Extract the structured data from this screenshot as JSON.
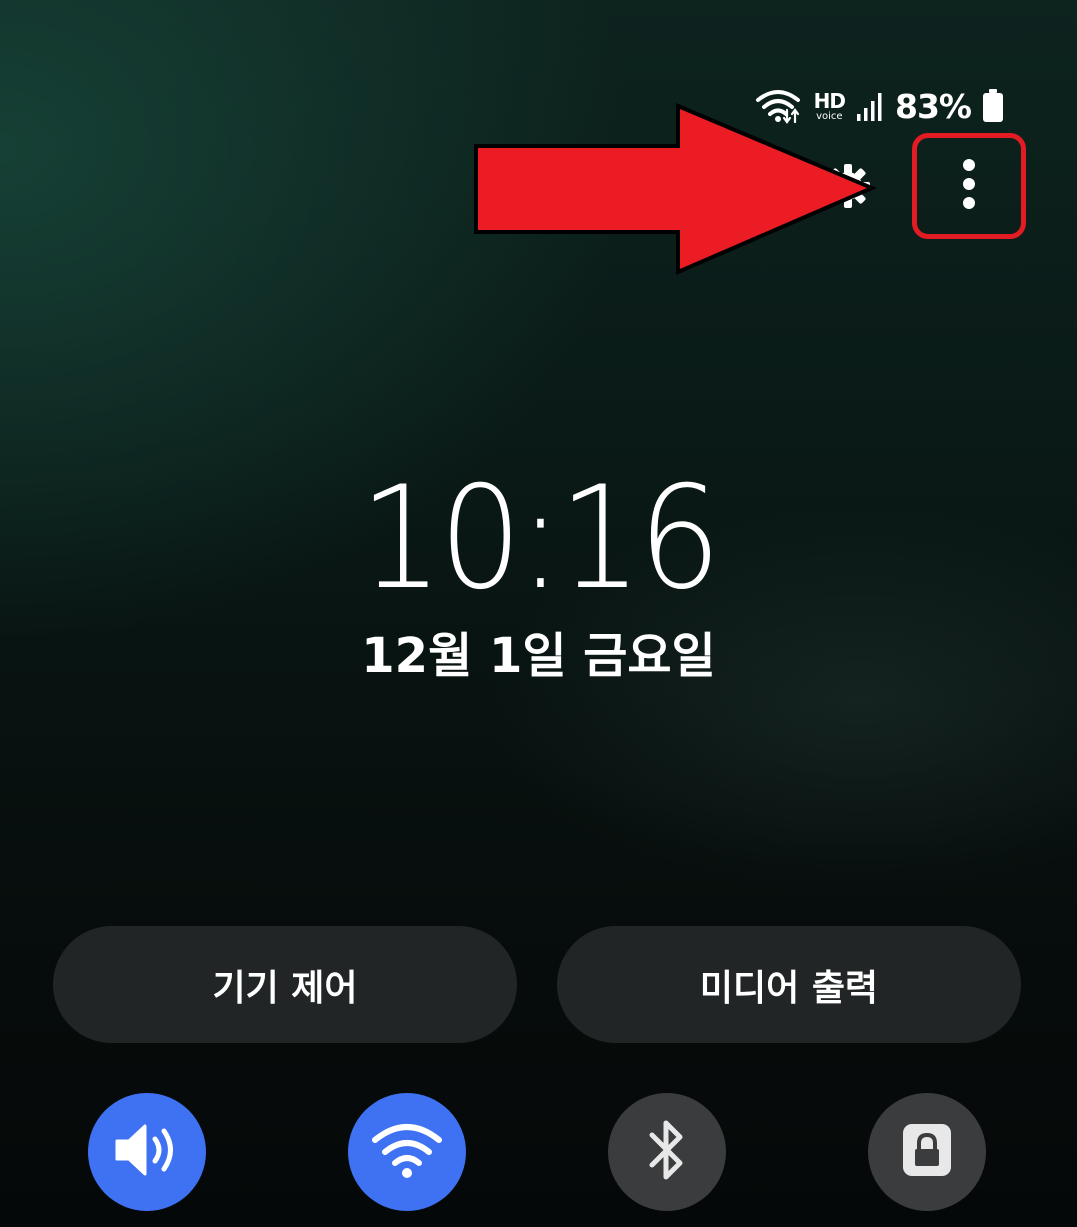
{
  "status_bar": {
    "wifi_icon": "wifi-data-arrows-icon",
    "hd_label": "HD",
    "voice_label": "voice",
    "signal_icon": "cell-signal-icon",
    "battery_percent": "83%",
    "battery_icon": "battery-icon",
    "battery_level": 0.83
  },
  "top_controls": {
    "settings_icon": "gear-icon",
    "more_icon": "more-vertical-icon",
    "highlight_color": "#e31b23",
    "annotation_arrow_color": "#ec1c24"
  },
  "lockscreen": {
    "time": "10:16",
    "date": "12월 1일 금요일"
  },
  "buttons": {
    "device_control": "기기 제어",
    "media_output": "미디어 출력"
  },
  "toggles": [
    {
      "name": "sound",
      "icon": "speaker-volume-icon",
      "state": "on"
    },
    {
      "name": "wifi",
      "icon": "wifi-icon",
      "state": "on"
    },
    {
      "name": "bluetooth",
      "icon": "bluetooth-icon",
      "state": "off"
    },
    {
      "name": "screen-lock",
      "icon": "lock-icon",
      "state": "off"
    }
  ],
  "colors": {
    "toggle_on": "#3f71f3",
    "toggle_off": "#3a3c3d",
    "pill_bg": "#222526"
  }
}
